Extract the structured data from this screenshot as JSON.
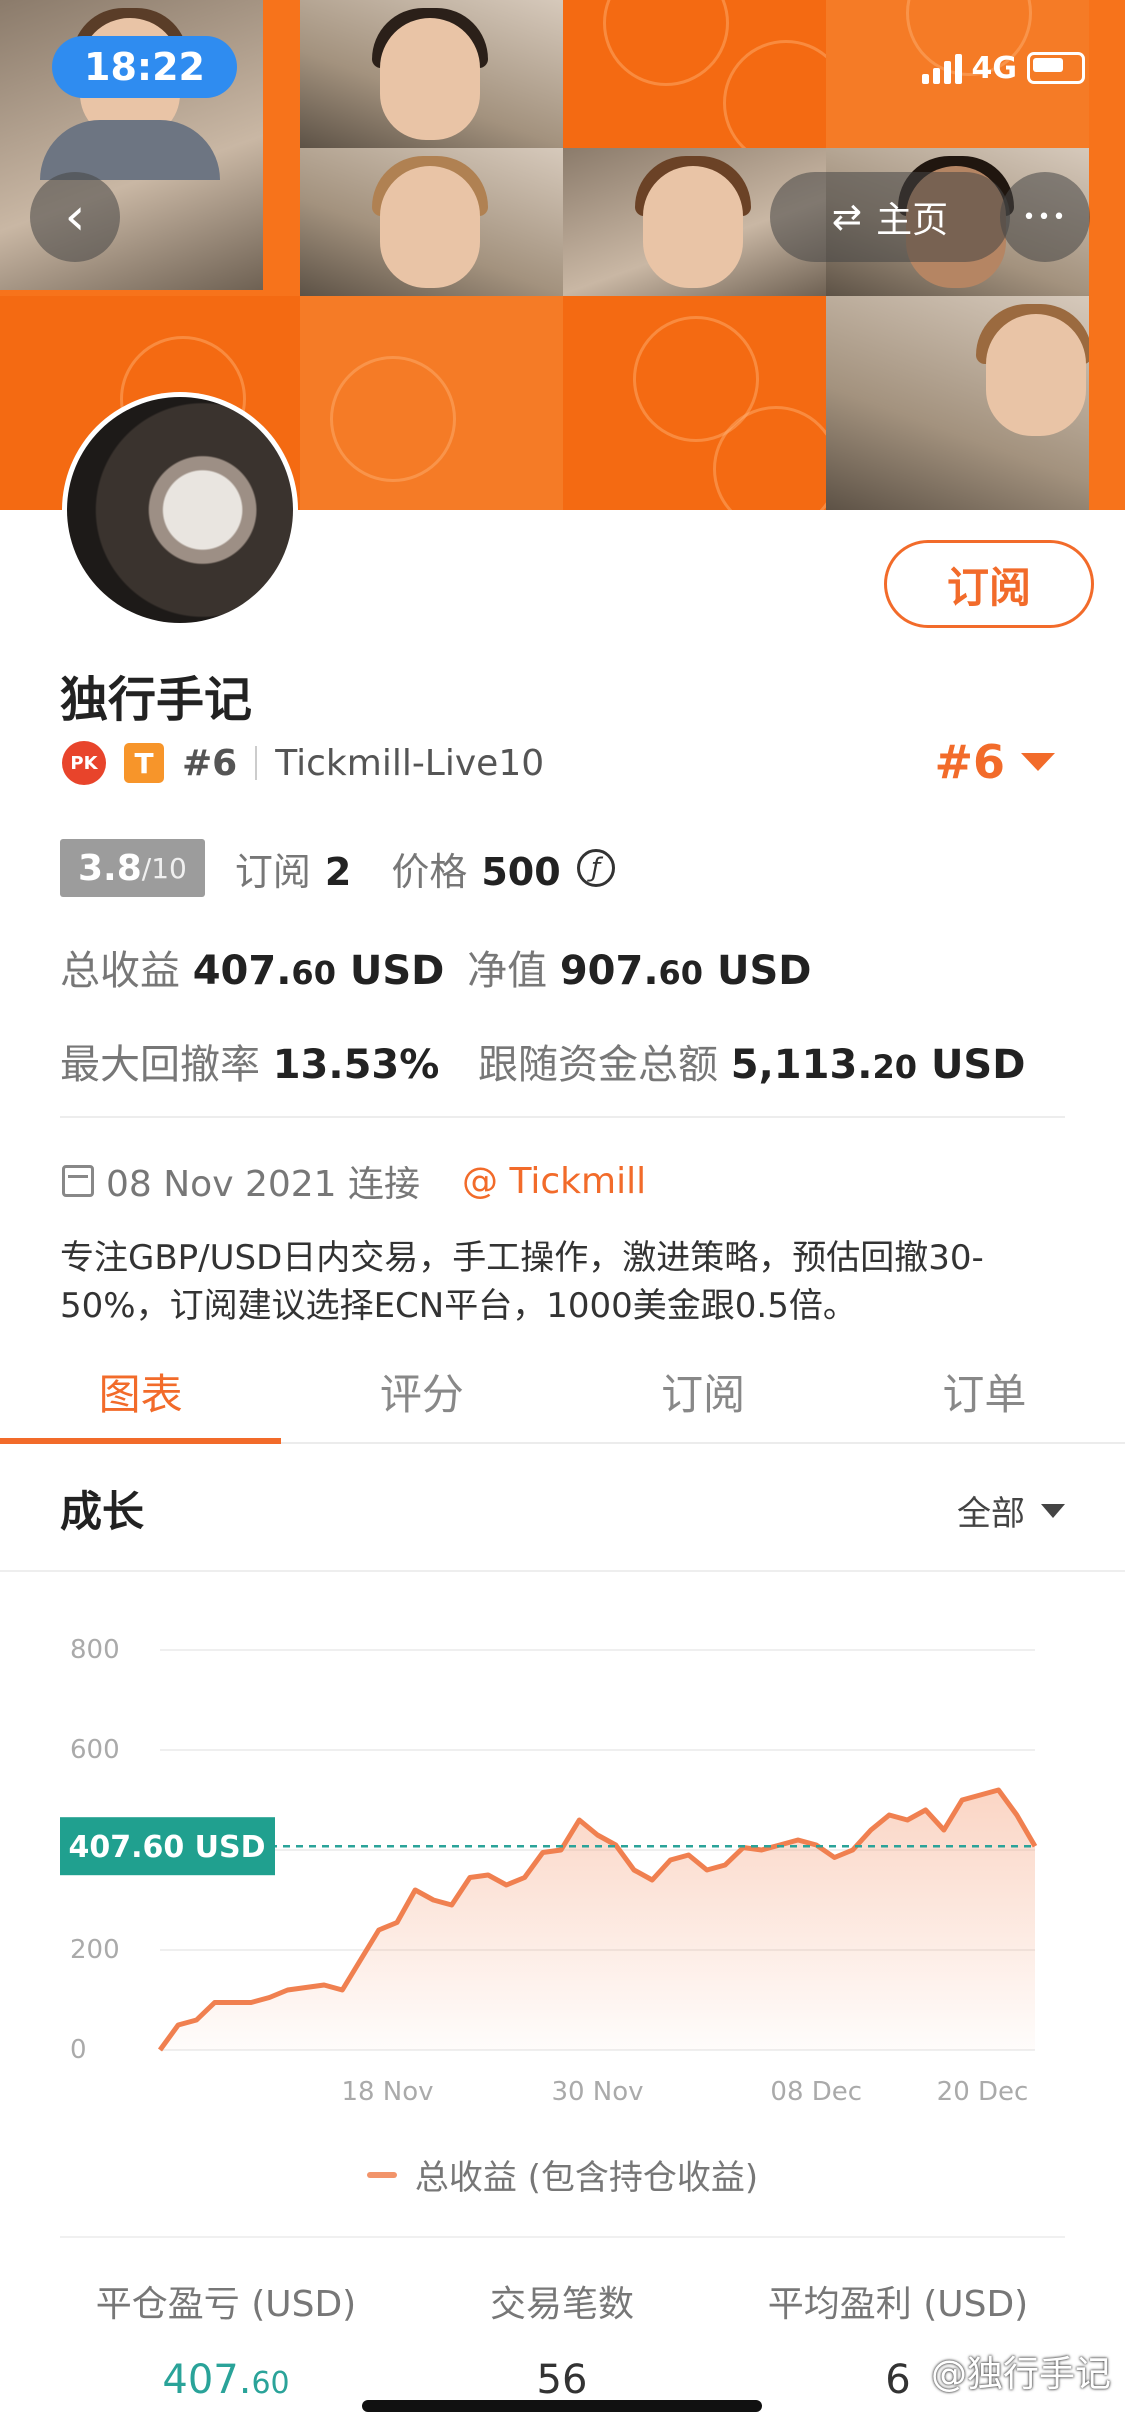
{
  "status_bar": {
    "time": "18:22",
    "network": "4G"
  },
  "nav": {
    "home_label": "主页",
    "back_symbol": "‹",
    "more_symbol": "•••",
    "swap_symbol": "⇄"
  },
  "profile": {
    "subscribe_label": "订阅",
    "name": "独行手记",
    "pk_badge": "PK",
    "type_badge": "T",
    "rank": "#6",
    "broker_account": "Tickmill-Live10",
    "rank_right": "#6"
  },
  "metrics": {
    "score_value": "3.8",
    "score_denominator": "/10",
    "subscriptions_label": "订阅",
    "subscriptions_value": "2",
    "price_label": "价格",
    "price_value": "500",
    "currency_symbol": "ƒ",
    "total_profit_label": "总收益",
    "total_profit_int": "407.",
    "total_profit_dec": "60",
    "total_profit_unit": "USD",
    "equity_label": "净值",
    "equity_int": "907.",
    "equity_dec": "60",
    "equity_unit": "USD",
    "max_drawdown_label": "最大回撤率",
    "max_drawdown_value": "13.53%",
    "follow_funds_label": "跟随资金总额",
    "follow_funds_int": "5,113.",
    "follow_funds_dec": "20",
    "follow_funds_unit": "USD"
  },
  "connection": {
    "date": "08 Nov 2021 连接",
    "broker_link": "@ Tickmill"
  },
  "description": "专注GBP/USD日内交易，手工操作，激进策略，预估回撤30-50%，订阅建议选择ECN平台，1000美金跟0.5倍。",
  "tabs": [
    {
      "label": "图表",
      "active": true
    },
    {
      "label": "评分",
      "active": false
    },
    {
      "label": "订阅",
      "active": false
    },
    {
      "label": "订单",
      "active": false
    }
  ],
  "growth": {
    "title": "成长",
    "range_label": "全部"
  },
  "chart_data": {
    "type": "area",
    "y_ticks": [
      "800",
      "600",
      "400",
      "200",
      "0"
    ],
    "x_ticks": [
      "18 Nov",
      "30 Nov",
      "08 Dec",
      "20 Dec"
    ],
    "ylim": [
      0,
      800
    ],
    "current_value_label": "407.60 USD",
    "current_value": 407.6,
    "series": [
      {
        "name": "总收益 (包含持仓收益)",
        "values": [
          0,
          50,
          60,
          95,
          95,
          95,
          105,
          120,
          125,
          130,
          120,
          180,
          240,
          255,
          320,
          300,
          290,
          345,
          350,
          330,
          345,
          395,
          400,
          460,
          430,
          410,
          360,
          340,
          380,
          390,
          360,
          370,
          405,
          400,
          410,
          420,
          410,
          385,
          400,
          440,
          470,
          460,
          480,
          440,
          500,
          510,
          520,
          470,
          407.6
        ]
      }
    ],
    "color": "#f08050",
    "grid": true
  },
  "summary": [
    {
      "label": "平仓盈亏 (USD)",
      "value_int": "407.",
      "value_dec": "60",
      "highlight": true
    },
    {
      "label": "交易笔数",
      "value_int": "56",
      "value_dec": "",
      "highlight": false
    },
    {
      "label": "平均盈利 (USD)",
      "value_int": "6",
      "value_dec": "",
      "highlight": false
    }
  ],
  "watermark": "@独行手记"
}
